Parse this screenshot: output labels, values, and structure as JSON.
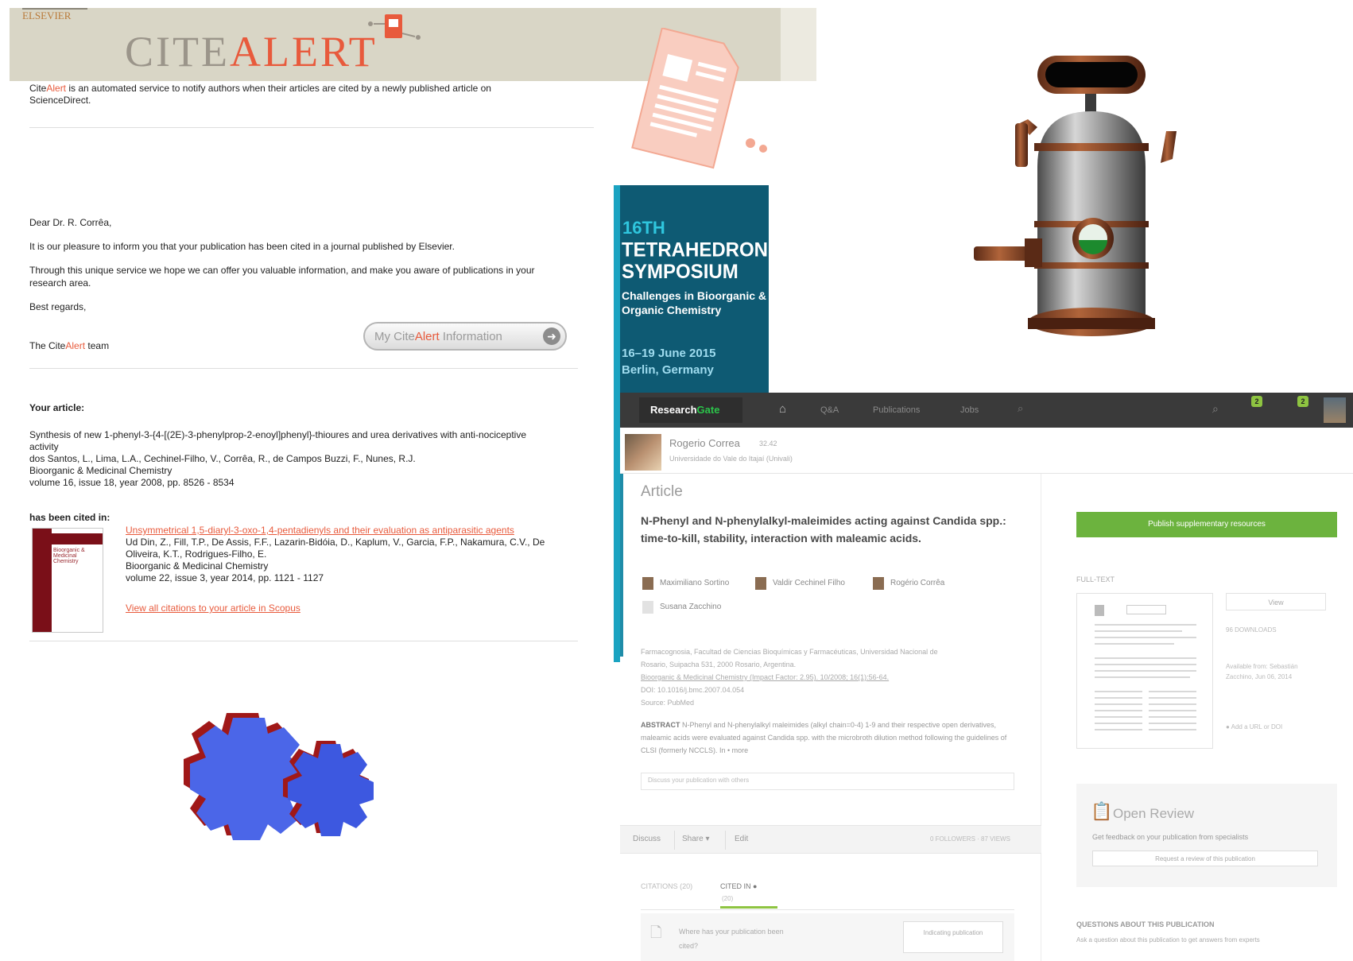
{
  "email": {
    "small_logo": "ELSEVIER",
    "logo_cite": "CITE",
    "logo_alert": "ALERT",
    "intro_cite": "Cite",
    "intro_alert": "Alert",
    "intro_rest": " is an automated service to notify authors when their articles are cited by a newly published article on ScienceDirect.",
    "greeting": "Dear Dr. R. Corrêa,",
    "p1": "It is our pleasure to inform you that your publication has been cited in a journal published by Elsevier.",
    "p2": "Through this unique service we hope we can offer you valuable information, and make you aware of publications in your research area.",
    "regards": "Best regards,",
    "sign_the": "The Cite",
    "sign_alert": "Alert",
    "sign_team": " team",
    "btn_my": "My Cite",
    "btn_alert": "Alert",
    "btn_info": " Information",
    "your_article_heading": "Your article:",
    "your_article": {
      "title": "Synthesis of new 1-phenyl-3-{4-[(2E)-3-phenylprop-2-enoyl]phenyl}-thioures and urea derivatives with anti-nociceptive activity",
      "authors": "dos Santos, L., Lima, L.A., Cechinel-Filho, V., Corrêa, R., de Campos Buzzi, F., Nunes, R.J.",
      "journal": "Bioorganic & Medicinal Chemistry",
      "volume": "volume 16, issue 18, year 2008, pp. 8526 - 8534"
    },
    "cited_in_heading": "has been cited in:",
    "citing_article": {
      "title": "Unsymmetrical 1,5-diaryl-3-oxo-1,4-pentadienyls and their evaluation as antiparasitic agents",
      "authors": "Ud Din, Z., Fill, T.P., De Assis, F.F., Lazarin-Bidóia, D., Kaplum, V., Garcia, F.P., Nakamura, C.V., De Oliveira, K.T., Rodrigues-Filho, E.",
      "journal": "Bioorganic & Medicinal Chemistry",
      "volume": "volume 22, issue 3, year 2014, pp. 1121 - 1127"
    },
    "view_all": "View all citations to your article in Scopus",
    "cover_text": "Bioorganic & Medicinal Chemistry"
  },
  "ad": {
    "number": "16TH",
    "title": "TETRAHEDRON SYMPOSIUM",
    "subtitle": "Challenges in Bioorganic & Organic Chemistry",
    "dates": "16–19 June 2015",
    "place": "Berlin, Germany",
    "color": "#0e5a73"
  },
  "researchgate": {
    "logo_research": "Research",
    "logo_gate": "Gate",
    "nav": [
      "Q&A",
      "Publications",
      "Jobs"
    ],
    "home_icon": "home-icon",
    "badge1": "2",
    "badge2": "2",
    "profile_name": "Rogerio Correa",
    "profile_score": "32.42",
    "profile_affiliation": "Universidade do Vale do Itajaí (Univali)",
    "article_label": "Article",
    "article_title": "N-Phenyl and N-phenylalkyl-maleimides acting against Candida spp.: time-to-kill, stability, interaction with maleamic acids.",
    "authors": [
      "Maximiliano Sortino",
      "Valdir Cechinel Filho",
      "Rogério Corrêa",
      "Susana Zacchino"
    ],
    "meta_line1": "Farmacognosia, Facultad de Ciencias Bioquímicas y Farmacéuticas, Universidad Nacional de",
    "meta_line2": "Rosario, Suipacha 531, 2000 Rosario, Argentina.",
    "meta_line3": "Bioorganic & Medicinal Chemistry (Impact Factor: 2.95). 10/2008; 16(1):56-64.",
    "meta_line4": "DOI: 10.1016/j.bmc.2007.04.054",
    "meta_line5": "Source: PubMed",
    "abstract_label": "ABSTRACT",
    "abstract_text": "N-Phenyl and N-phenylalkyl maleimides (alkyl chain=0-4) 1-9 and their respective open derivatives, maleamic acids were evaluated against Candida spp. with the microbroth dilution method following the guidelines of CLSI (formerly NCCLS). In • more",
    "comment_placeholder": "Discuss your publication with others",
    "actions": [
      "Discuss",
      "Share ▾",
      "Edit"
    ],
    "stats": "0 FOLLOWERS · 87 VIEWS",
    "tab_citations": "CITATIONS (20)",
    "tab_cited": "CITED IN ●",
    "tab_cited_sub": "(20)",
    "cited_question": "Where has your publication been cited?",
    "indicate_btn": "Indicating publication",
    "publish_btn": "Publish supplementary resources",
    "full_text": "FULL-TEXT",
    "view_btn": "View",
    "downloads": "96 DOWNLOADS",
    "available": "Available from: Sebastián Zacchino, Jun 06, 2014",
    "add_url": "● Add a URL or DOI",
    "open_review_title": "Open Review",
    "open_review_text": "Get feedback on your publication from specialists",
    "open_review_btn": "Request a review of this publication",
    "questions_heading": "QUESTIONS ABOUT THIS PUBLICATION",
    "questions_text": "Ask a question about this publication to get answers from experts",
    "accent": "#6cb33e"
  }
}
